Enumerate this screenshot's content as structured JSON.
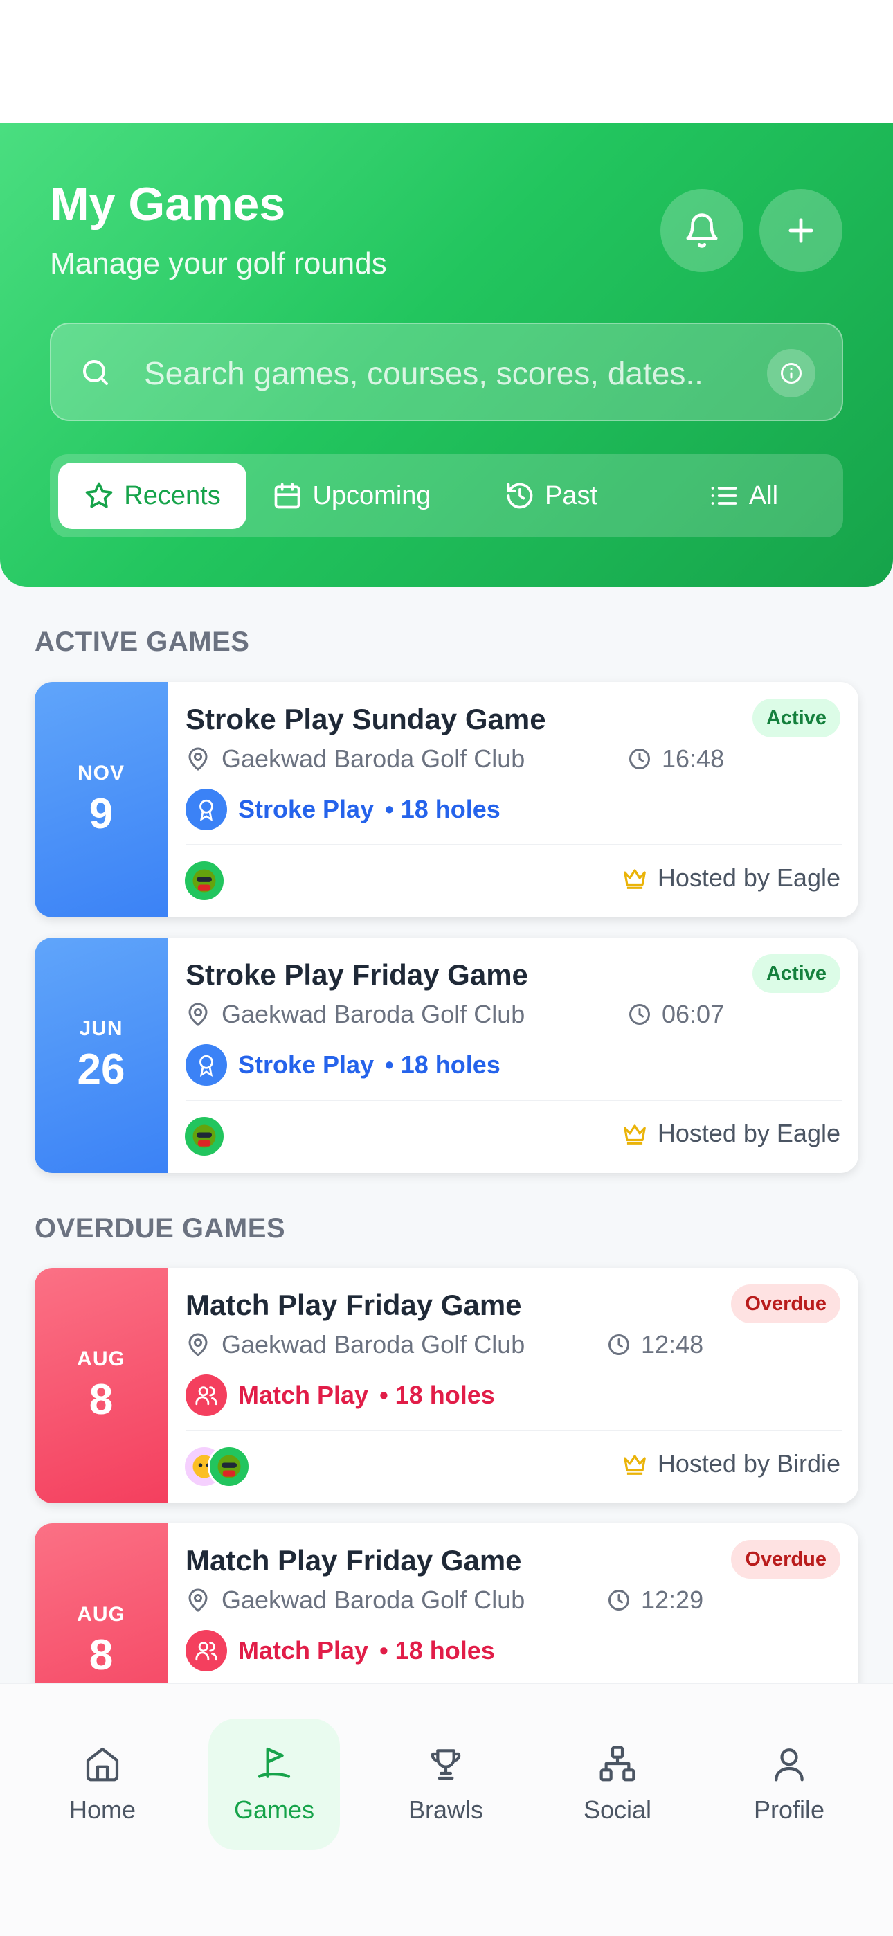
{
  "header": {
    "title": "My Games",
    "subtitle": "Manage your golf rounds",
    "bell_icon": "bell-icon",
    "add_icon": "plus-icon"
  },
  "search": {
    "placeholder": "Search games, courses, scores, dates..",
    "icon": "search-icon",
    "info_icon": "info-icon"
  },
  "tabs": [
    {
      "label": "Recents",
      "icon": "star-icon",
      "active": true
    },
    {
      "label": "Upcoming",
      "icon": "calendar-icon",
      "active": false
    },
    {
      "label": "Past",
      "icon": "history-icon",
      "active": false
    },
    {
      "label": "All",
      "icon": "list-icon",
      "active": false
    }
  ],
  "sections": {
    "active": "ACTIVE GAMES",
    "overdue": "OVERDUE GAMES"
  },
  "games": [
    {
      "month": "NOV",
      "day": "9",
      "title": "Stroke Play Sunday Game",
      "status": "Active",
      "course": "Gaekwad Baroda Golf Club",
      "time": "16:48",
      "mode": "Stroke Play",
      "holes": "• 18 holes",
      "host": "Hosted by Eagle"
    },
    {
      "month": "JUN",
      "day": "26",
      "title": "Stroke Play Friday Game",
      "status": "Active",
      "course": "Gaekwad Baroda Golf Club",
      "time": "06:07",
      "mode": "Stroke Play",
      "holes": "• 18 holes",
      "host": "Hosted by Eagle"
    },
    {
      "month": "AUG",
      "day": "8",
      "title": "Match Play Friday Game",
      "status": "Overdue",
      "course": "Gaekwad Baroda Golf Club",
      "time": "12:48",
      "mode": "Match Play",
      "holes": "• 18 holes",
      "host": "Hosted by Birdie"
    },
    {
      "month": "AUG",
      "day": "8",
      "title": "Match Play Friday Game",
      "status": "Overdue",
      "course": "Gaekwad Baroda Golf Club",
      "time": "12:29",
      "mode": "Match Play",
      "holes": "• 18 holes",
      "host": ""
    }
  ],
  "nav": [
    {
      "label": "Home",
      "icon": "home-icon"
    },
    {
      "label": "Games",
      "icon": "flag-icon",
      "active": true
    },
    {
      "label": "Brawls",
      "icon": "trophy-icon"
    },
    {
      "label": "Social",
      "icon": "network-icon"
    },
    {
      "label": "Profile",
      "icon": "user-icon"
    }
  ],
  "colors": {
    "brand_green": "#22c55e",
    "active_blue": "#3b82f6",
    "overdue_red": "#f43f5e"
  }
}
